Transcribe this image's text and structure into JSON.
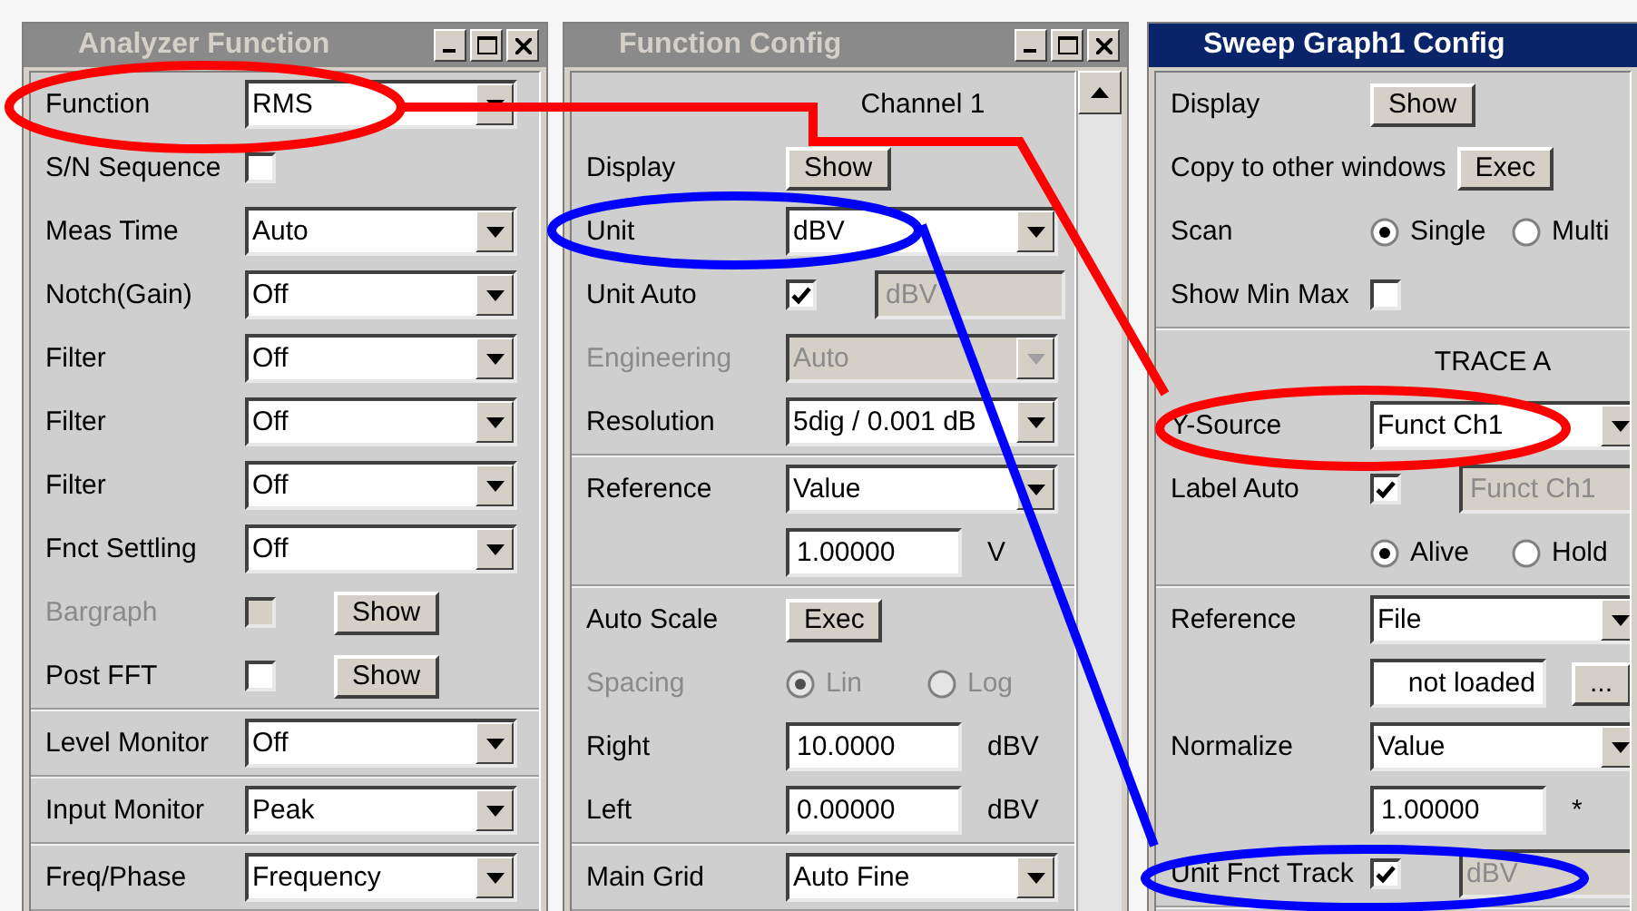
{
  "panels": [
    {
      "title": "Analyzer Function",
      "active": false,
      "window_controls": true,
      "scrollbar": false,
      "sections": [
        {
          "rows": [
            {
              "kind": "setting",
              "label": "Function",
              "disabled": false,
              "controls": [
                {
                  "kind": "dropdown",
                  "value": "RMS",
                  "disabled": false
                }
              ]
            },
            {
              "kind": "setting",
              "label": "S/N Sequence",
              "disabled": false,
              "controls": [
                {
                  "kind": "checkbox",
                  "checked": false,
                  "disabled": false
                }
              ]
            },
            {
              "kind": "setting",
              "label": "Meas Time",
              "disabled": false,
              "controls": [
                {
                  "kind": "dropdown",
                  "value": "Auto",
                  "disabled": false
                }
              ]
            },
            {
              "kind": "setting",
              "label": "Notch(Gain)",
              "disabled": false,
              "controls": [
                {
                  "kind": "dropdown",
                  "value": "Off",
                  "disabled": false
                }
              ]
            },
            {
              "kind": "setting",
              "label": "Filter",
              "disabled": false,
              "controls": [
                {
                  "kind": "dropdown",
                  "value": "Off",
                  "disabled": false
                }
              ]
            },
            {
              "kind": "setting",
              "label": "Filter",
              "disabled": false,
              "controls": [
                {
                  "kind": "dropdown",
                  "value": "Off",
                  "disabled": false
                }
              ]
            },
            {
              "kind": "setting",
              "label": "Filter",
              "disabled": false,
              "controls": [
                {
                  "kind": "dropdown",
                  "value": "Off",
                  "disabled": false
                }
              ]
            },
            {
              "kind": "setting",
              "label": "Fnct Settling",
              "disabled": false,
              "controls": [
                {
                  "kind": "dropdown",
                  "value": "Off",
                  "disabled": false
                }
              ]
            },
            {
              "kind": "setting",
              "label": "Bargraph",
              "disabled": true,
              "controls": [
                {
                  "kind": "checkbox",
                  "checked": false,
                  "disabled": true
                },
                {
                  "kind": "button",
                  "label": "Show"
                }
              ]
            },
            {
              "kind": "setting",
              "label": "Post FFT",
              "disabled": false,
              "controls": [
                {
                  "kind": "checkbox",
                  "checked": false,
                  "disabled": false
                },
                {
                  "kind": "button",
                  "label": "Show"
                }
              ]
            }
          ]
        },
        {
          "rows": [
            {
              "kind": "setting",
              "label": "Level Monitor",
              "disabled": false,
              "controls": [
                {
                  "kind": "dropdown",
                  "value": "Off",
                  "disabled": false
                }
              ]
            }
          ]
        },
        {
          "rows": [
            {
              "kind": "setting",
              "label": "Input Monitor",
              "disabled": false,
              "controls": [
                {
                  "kind": "dropdown",
                  "value": "Peak",
                  "disabled": false
                }
              ]
            }
          ]
        },
        {
          "rows": [
            {
              "kind": "setting",
              "label": "Freq/Phase",
              "disabled": false,
              "controls": [
                {
                  "kind": "dropdown",
                  "value": "Frequency",
                  "disabled": false
                }
              ]
            }
          ]
        }
      ]
    },
    {
      "title": "Function Config",
      "active": false,
      "window_controls": true,
      "scrollbar": true,
      "sections": [
        {
          "rows": [
            {
              "kind": "heading",
              "label": "Channel 1"
            },
            {
              "kind": "setting",
              "label": "Display",
              "disabled": false,
              "controls": [
                {
                  "kind": "button",
                  "label": "Show"
                }
              ]
            },
            {
              "kind": "setting",
              "label": "Unit",
              "disabled": false,
              "controls": [
                {
                  "kind": "dropdown",
                  "value": "dBV",
                  "disabled": false
                }
              ]
            },
            {
              "kind": "setting",
              "label": "Unit Auto",
              "disabled": false,
              "controls": [
                {
                  "kind": "checkbox",
                  "checked": true,
                  "disabled": false
                },
                {
                  "kind": "field",
                  "value": "dBV",
                  "disabled": true
                }
              ]
            },
            {
              "kind": "setting",
              "label": "Engineering",
              "disabled": true,
              "controls": [
                {
                  "kind": "dropdown",
                  "value": "Auto",
                  "disabled": true
                }
              ]
            },
            {
              "kind": "setting",
              "label": "Resolution",
              "disabled": false,
              "controls": [
                {
                  "kind": "dropdown",
                  "value": "5dig / 0.001 dB",
                  "disabled": false
                }
              ]
            }
          ]
        },
        {
          "rows": [
            {
              "kind": "setting",
              "label": "Reference",
              "disabled": false,
              "controls": [
                {
                  "kind": "dropdown",
                  "value": "Value",
                  "disabled": false
                }
              ]
            },
            {
              "kind": "setting",
              "controls": [
                {
                  "kind": "field",
                  "value": "1.00000",
                  "disabled": false
                },
                {
                  "kind": "unit",
                  "value": "V"
                }
              ]
            }
          ]
        },
        {
          "rows": [
            {
              "kind": "setting",
              "label": "Auto Scale",
              "disabled": false,
              "controls": [
                {
                  "kind": "button",
                  "label": "Exec"
                }
              ]
            },
            {
              "kind": "setting",
              "label": "Spacing",
              "disabled": true,
              "controls": [
                {
                  "kind": "radio",
                  "label": "Lin",
                  "selected": true,
                  "disabled": true
                },
                {
                  "kind": "radio",
                  "label": "Log",
                  "selected": false,
                  "disabled": true
                }
              ]
            },
            {
              "kind": "setting",
              "label": "Right",
              "disabled": false,
              "controls": [
                {
                  "kind": "field",
                  "value": "10.0000",
                  "disabled": false
                },
                {
                  "kind": "unit",
                  "value": "dBV"
                }
              ]
            },
            {
              "kind": "setting",
              "label": "Left",
              "disabled": false,
              "controls": [
                {
                  "kind": "field",
                  "value": "0.00000",
                  "disabled": false
                },
                {
                  "kind": "unit",
                  "value": "dBV"
                }
              ]
            }
          ]
        },
        {
          "rows": [
            {
              "kind": "setting",
              "label": "Main Grid",
              "disabled": false,
              "controls": [
                {
                  "kind": "dropdown",
                  "value": "Auto Fine",
                  "disabled": false
                }
              ]
            }
          ]
        }
      ]
    },
    {
      "title": "Sweep Graph1 Config",
      "active": true,
      "window_controls": false,
      "scrollbar": false,
      "sections": [
        {
          "rows": [
            {
              "kind": "setting",
              "label": "Display",
              "disabled": false,
              "controls": [
                {
                  "kind": "button",
                  "label": "Show"
                }
              ]
            },
            {
              "kind": "setting",
              "label": "Copy to other windows",
              "disabled": false,
              "controls": [
                {
                  "kind": "button",
                  "label": "Exec"
                }
              ]
            },
            {
              "kind": "setting",
              "label": "Scan",
              "disabled": false,
              "controls": [
                {
                  "kind": "radio",
                  "label": "Single",
                  "selected": true,
                  "disabled": false
                },
                {
                  "kind": "radio",
                  "label": "Multi",
                  "selected": false,
                  "disabled": false
                }
              ]
            },
            {
              "kind": "setting",
              "label": "Show Min Max",
              "disabled": false,
              "controls": [
                {
                  "kind": "checkbox",
                  "checked": false,
                  "disabled": false
                }
              ]
            }
          ]
        },
        {
          "rows": [
            {
              "kind": "heading",
              "label": "TRACE A"
            },
            {
              "kind": "setting",
              "label": "Y-Source",
              "disabled": false,
              "controls": [
                {
                  "kind": "dropdown",
                  "value": "Funct Ch1",
                  "disabled": false
                }
              ]
            },
            {
              "kind": "setting",
              "label": "Label Auto",
              "disabled": false,
              "controls": [
                {
                  "kind": "checkbox",
                  "checked": true,
                  "disabled": false
                },
                {
                  "kind": "field",
                  "value": "Funct Ch1",
                  "disabled": true
                }
              ]
            },
            {
              "kind": "setting",
              "controls": [
                {
                  "kind": "radio",
                  "label": "Alive",
                  "selected": true,
                  "disabled": false
                },
                {
                  "kind": "radio",
                  "label": "Hold",
                  "selected": false,
                  "disabled": false
                }
              ]
            }
          ]
        },
        {
          "rows": [
            {
              "kind": "setting",
              "label": "Reference",
              "disabled": false,
              "controls": [
                {
                  "kind": "dropdown",
                  "value": "File",
                  "disabled": false
                }
              ]
            },
            {
              "kind": "setting",
              "controls": [
                {
                  "kind": "field",
                  "value": "not loaded",
                  "disabled": false,
                  "right_aligned": true
                },
                {
                  "kind": "button",
                  "label": "..."
                }
              ]
            },
            {
              "kind": "setting",
              "label": "Normalize",
              "disabled": false,
              "controls": [
                {
                  "kind": "dropdown",
                  "value": "Value",
                  "disabled": false
                }
              ]
            },
            {
              "kind": "setting",
              "controls": [
                {
                  "kind": "field",
                  "value": "1.00000",
                  "disabled": false
                },
                {
                  "kind": "unit",
                  "value": "*"
                }
              ]
            },
            {
              "kind": "setting",
              "label": "Unit Fnct Track",
              "disabled": false,
              "controls": [
                {
                  "kind": "checkbox",
                  "checked": true,
                  "disabled": false
                },
                {
                  "kind": "dropdown",
                  "value": "dBV",
                  "disabled": true
                }
              ]
            }
          ]
        }
      ]
    }
  ]
}
